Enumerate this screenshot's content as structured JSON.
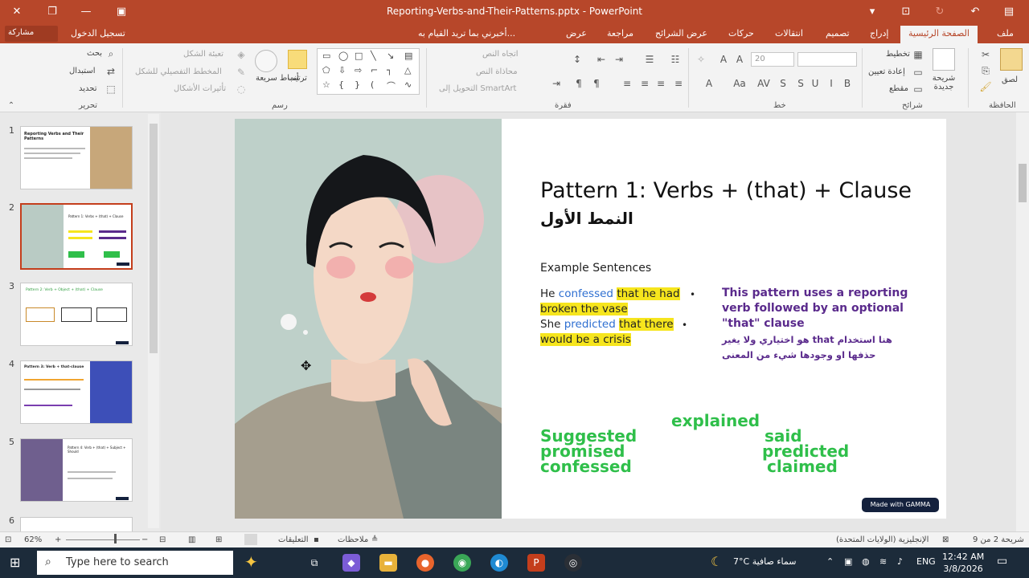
{
  "window": {
    "title": "Reporting-Verbs-and-Their-Patterns.pptx - PowerPoint",
    "sign_in": "تسجيل الدخول",
    "share": "مشاركة",
    "tell_me": "أخبرني بما تريد القيام به..."
  },
  "tabs": [
    "ملف",
    "الصفحة الرئيسية",
    "إدراج",
    "تصميم",
    "انتقالات",
    "حركات",
    "عرض الشرائح",
    "مراجعة",
    "عرض"
  ],
  "active_tab": "الصفحة الرئيسية",
  "ribbon": {
    "clipboard": {
      "label": "الحافظة",
      "paste": "لصق"
    },
    "slides": {
      "label": "شرائح",
      "new_slide": "شريحة جديدة",
      "layout": "تخطيط",
      "reset": "إعادة تعيين",
      "section": "مقطع"
    },
    "font": {
      "label": "خط",
      "size": "20"
    },
    "paragraph": {
      "label": "فقرة",
      "text_direction": "اتجاه النص",
      "align_text": "محاذاة النص",
      "smartart": "التحويل إلى SmartArt"
    },
    "drawing": {
      "label": "رسم",
      "arrange": "ترتيب",
      "quick_styles": "أنماط سريعة",
      "shape_fill": "تعبئة الشكل",
      "shape_outline": "المخطط التفصيلي للشكل",
      "shape_effects": "تأثيرات الأشكال"
    },
    "editing": {
      "label": "تحرير",
      "find": "بحث",
      "replace": "استبدال",
      "select": "تحديد"
    }
  },
  "thumbnails": [
    {
      "num": "1",
      "title": "Reporting Verbs and Their Patterns"
    },
    {
      "num": "2",
      "title": "Pattern 1: Verbs + (that) + Clause"
    },
    {
      "num": "3",
      "title": "Pattern 2: Verb + Object + (that) + Clause"
    },
    {
      "num": "4",
      "title": "Pattern 3: Verb + that-clause"
    },
    {
      "num": "5",
      "title": "Pattern 4: Verb + (that) + Subject + Should"
    },
    {
      "num": "6",
      "title": ""
    }
  ],
  "slide": {
    "title": "Pattern 1: Verbs + (that) + Clause",
    "title_ar": "النمط الأول",
    "heading": "Example Sentences",
    "ex1": {
      "subj": "He",
      "verb": "confessed",
      "clause_a": "that he had",
      "clause_b": "broken the vase"
    },
    "ex2": {
      "subj": "She",
      "verb": "predicted",
      "clause_a": "that there",
      "clause_b": "would be a crisis"
    },
    "bullet": "•",
    "note_lines": [
      "This pattern uses a reporting",
      "verb followed by an optional",
      "\"that\" clause"
    ],
    "note_ar_1": "هنا استخدام that هو اختياري ولا يغير",
    "note_ar_2": "حذفها او وجودها شيء من المعنى",
    "words": {
      "explained": "explained",
      "suggested": "Suggested",
      "promised": "promised",
      "confessed": "confessed",
      "said": "said",
      "predicted": "predicted",
      "claimed": "claimed"
    },
    "badge": "Made with GAMMA"
  },
  "status": {
    "slide_pos": "شريحة 2 من 9",
    "language": "الإنجليزية (الولايات المتحدة)",
    "notes": "ملاحظات",
    "comments": "التعليقات",
    "zoom": "62%"
  },
  "taskbar": {
    "search_placeholder": "Type here to search",
    "weather": "7°C  سماء صافية",
    "lang": "ENG",
    "time": "12:42 AM",
    "date": "3/8/2026"
  },
  "colors": {
    "accent": "#b7472a",
    "verb_blue": "#2e6fd1",
    "highlight": "#f6e51d",
    "note_purple": "#5a2a8c",
    "word_green": "#2fbf4a"
  }
}
